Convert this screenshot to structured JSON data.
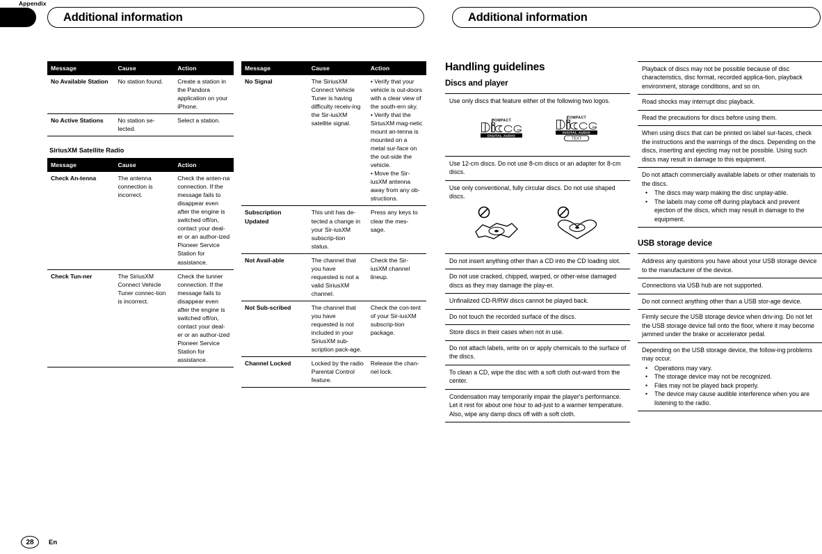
{
  "appendix_tab": {
    "label": "Appendix"
  },
  "headers": {
    "left": "Additional information",
    "right": "Additional information"
  },
  "footer": {
    "page_number": "28",
    "language": "En"
  },
  "column1": {
    "pandora_table": {
      "columns": [
        "Message",
        "Cause",
        "Action"
      ],
      "rows": [
        {
          "message": "No Available Station",
          "cause": "No station found.",
          "action": "Create a station in the Pandora application on your iPhone."
        },
        {
          "message": "No Active Stations",
          "cause": "No station se-lected.",
          "action": "Select a station."
        }
      ]
    },
    "siriusxm_heading": "SiriusXM Satellite Radio",
    "siriusxm_table": {
      "columns": [
        "Message",
        "Cause",
        "Action"
      ],
      "rows": [
        {
          "message": "Check An-tenna",
          "cause": "The antenna connection is incorrect.",
          "action": "Check the anten-na connection. If the message fails to disappear even after the engine is switched off/on, contact your deal-er or an author-ized Pioneer Service Station for assistance."
        },
        {
          "message": "Check Tun-ner",
          "cause": "The SiriusXM Connect Vehicle Tuner connec-tion is incorrect.",
          "action": "Check the tunner connection. If the message fails to disappear even after the engine is switched off/on, contact your deal-er or an author-ized Pioneer Service Station for assistance."
        }
      ]
    }
  },
  "column2": {
    "siriusxm_table_cont": {
      "columns": [
        "Message",
        "Cause",
        "Action"
      ],
      "rows": [
        {
          "message": "No Signal",
          "cause": "The SiriusXM Connect Vehicle Tuner is having difficulty receiv-ing the Sir-iusXM satellite signal.",
          "action": "• Verify that your vehicle is out-doors with a clear view of the south-ern sky.\n• Verify that the SiriusXM mag-netic mount an-tenna is mounted on a metal sur-face on the out-side the vehicle.\n• Move the Sir-iusXM antenna away from any ob-structions."
        },
        {
          "message": "Subscription Updated",
          "cause": "This unit has de-tected a change in your Sir-iusXM subscrip-tion status.",
          "action": "Press any keys to clear the mes-sage."
        },
        {
          "message": "Not Avail-able",
          "cause": "The channel that you have requested is not a valid SiriusXM channel.",
          "action": "Check the Sir-iusXM channel lineup."
        },
        {
          "message": "Not Sub-scribed",
          "cause": "The channel that you have requested is not included in your SiriusXM sub-scription pack-age.",
          "action": "Check the con-tent of your Sir-iusXM subscrip-tion package."
        },
        {
          "message": "Channel Locked",
          "cause": "Locked by the radio Parental Control feature.",
          "action": "Release the chan-nel lock."
        }
      ]
    }
  },
  "column3": {
    "section_title": "Handling guidelines",
    "sub_title": "Discs and player",
    "items": [
      {
        "type": "text_with_logos",
        "text": "Use only discs that feature either of the following two logos.",
        "logos": [
          {
            "name": "compact-disc-digital-audio-logo",
            "top": "COMPACT",
            "mid": "disc",
            "bottom": "DIGITAL AUDIO",
            "extra": ""
          },
          {
            "name": "compact-disc-digital-audio-text-logo",
            "top": "COMPACT",
            "mid": "disc",
            "bottom": "DIGITAL AUDIO",
            "extra": "TEXT"
          }
        ]
      },
      {
        "type": "text",
        "text": "Use 12-cm discs. Do not use 8-cm discs or an adapter for 8-cm discs."
      },
      {
        "type": "text_with_shapes",
        "text": "Use only conventional, fully circular discs. Do not use shaped discs."
      },
      {
        "type": "text",
        "text": "Do not insert anything other than a CD into the CD loading slot."
      },
      {
        "type": "text",
        "text": "Do not use cracked, chipped, warped, or other-wise damaged discs as they may damage the play-er."
      },
      {
        "type": "text",
        "text": "Unfinalized CD-R/RW discs cannot be played back."
      },
      {
        "type": "text",
        "text": "Do not touch the recorded surface of the discs."
      },
      {
        "type": "text",
        "text": "Store discs in their cases when not in use."
      },
      {
        "type": "text",
        "text": "Do not attach labels, write on or apply chemicals to the surface of the discs."
      },
      {
        "type": "text",
        "text": "To clean a CD, wipe the disc with a soft cloth out-ward from the center."
      },
      {
        "type": "text",
        "text": "Condensation may temporarily impair the player's performance. Let it rest for about one hour to ad-just to a warmer temperature. Also, wipe any damp discs off with a soft cloth."
      }
    ]
  },
  "column4": {
    "disc_items": [
      {
        "text": "Playback of discs may not be possible because of disc characteristics, disc format, recorded applica-tion, playback environment, storage conditions, and so on.",
        "bullets": []
      },
      {
        "text": "Road shocks may interrupt disc playback.",
        "bullets": []
      },
      {
        "text": "Read the precautions for discs before using them.",
        "bullets": []
      },
      {
        "text": "When using discs that can be printed on label sur-faces, check the instructions and the warnings of the discs. Depending on the discs, inserting and ejecting may not be possible. Using such discs may result in damage to this equipment.",
        "bullets": []
      },
      {
        "text": "Do not attach commercially available labels or other materials to the discs.",
        "bullets": [
          "The discs may warp making the disc unplay-able.",
          "The labels may come off during playback and prevent ejection of the discs, which may result in damage to the equipment."
        ]
      }
    ],
    "usb_title": "USB storage device",
    "usb_items": [
      {
        "text": "Address any questions you have about your USB storage device to the manufacturer of the device.",
        "bullets": []
      },
      {
        "text": "Connections via USB hub are not supported.",
        "bullets": []
      },
      {
        "text": "Do not connect anything other than a USB stor-age device.",
        "bullets": []
      },
      {
        "text": "Firmly secure the USB storage device when driv-ing. Do not let the USB storage device fall onto the floor, where it may become jammed under the brake or accelerator pedal.",
        "bullets": []
      },
      {
        "text": "Depending on the USB storage device, the follow-ing problems may occur.",
        "bullets": [
          "Operations may vary.",
          "The storage device may not be recognized.",
          "Files may not be played back properly.",
          "The device may cause audible interference when you are listening to the radio."
        ]
      }
    ]
  }
}
